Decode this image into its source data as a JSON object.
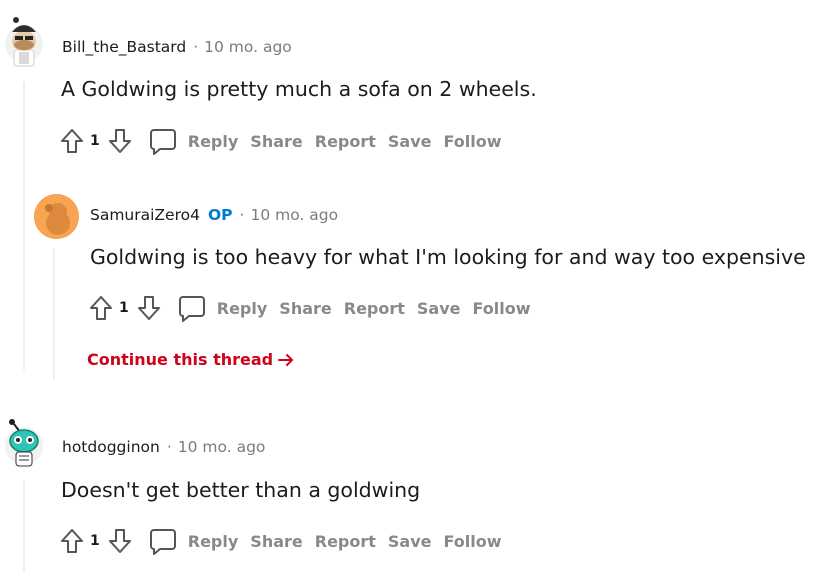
{
  "comments": [
    {
      "author": "Bill_the_Bastard",
      "op_badge": "",
      "time": "10 mo. ago",
      "text": "A Goldwing is pretty much a sofa on 2 wheels.",
      "score": "1"
    },
    {
      "author": "SamuraiZero4",
      "op_badge": "OP",
      "time": "10 mo. ago",
      "text": "Goldwing is too heavy for what I'm looking for and way too expensive",
      "score": "1"
    },
    {
      "author": "hotdogginon",
      "op_badge": "",
      "time": "10 mo. ago",
      "text": "Doesn't get better than a goldwing",
      "score": "1"
    }
  ],
  "actions": {
    "reply": "Reply",
    "share": "Share",
    "report": "Report",
    "save": "Save",
    "follow": "Follow"
  },
  "separator": "·",
  "continue_thread": "Continue this thread",
  "icons": {
    "upvote": "arrow-up-outline-icon",
    "downvote": "arrow-down-outline-icon",
    "comment": "speech-bubble-icon",
    "continue": "arrow-right-icon"
  },
  "colors": {
    "op_badge": "#0079d3",
    "continue_link": "#d0021b",
    "action_text": "#878a8c",
    "meta_text": "#7c7c7c"
  }
}
